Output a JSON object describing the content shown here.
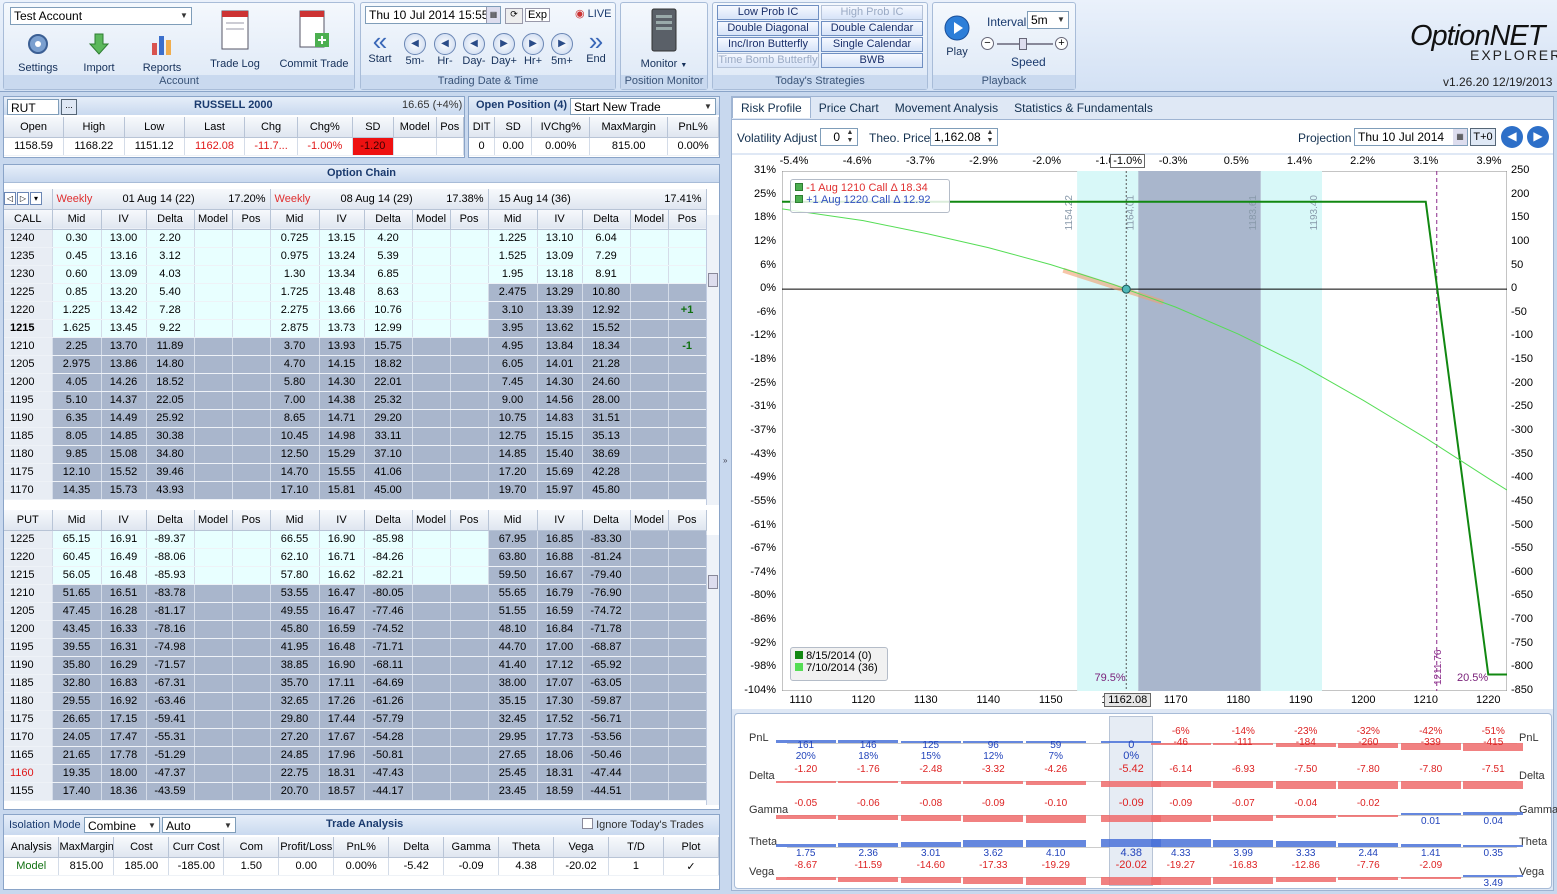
{
  "ribbon": {
    "account": "Test Account",
    "buttons": [
      "Settings",
      "Import",
      "Reports",
      "Trade Log",
      "Commit Trade"
    ],
    "account_title": "Account",
    "datetime": "Thu 10 Jul 2014  15:55",
    "exp": "Exp",
    "live": "LIVE",
    "nav": [
      "Start",
      "5m-",
      "Hr-",
      "Day-",
      "Day+",
      "Hr+",
      "5m+",
      "End"
    ],
    "trading_title": "Trading Date & Time",
    "monitor": "Monitor",
    "monitor_title": "Position Monitor",
    "strategies": [
      [
        "Low Prob IC",
        "High Prob IC"
      ],
      [
        "Double Diagonal",
        "Double Calendar"
      ],
      [
        "Inc/Iron Butterfly",
        "Single Calendar"
      ],
      [
        "Time Bomb Butterfly",
        "BWB"
      ]
    ],
    "strategies_title": "Today's Strategies",
    "play": "Play",
    "interval_label": "Interval",
    "interval": "5m",
    "speed": "Speed",
    "playback_title": "Playback",
    "logo1": "OptionNET",
    "logo2": "EXPLORER",
    "version": "v1.26.20  12/19/2013"
  },
  "quote": {
    "symbol": "RUT",
    "name": "RUSSELL 2000",
    "change": "16.65 (+4%)",
    "headers": [
      "Open",
      "High",
      "Low",
      "Last",
      "Chg",
      "Chg%",
      "SD",
      "Model",
      "Pos"
    ],
    "values": [
      "1158.59",
      "1168.22",
      "1151.12",
      "1162.08",
      "-11.7...",
      "-1.00%",
      "-1.20",
      "",
      ""
    ]
  },
  "position": {
    "title": "Open Position (4)",
    "select": "Start New Trade",
    "headers": [
      "DIT",
      "SD",
      "IVChg%",
      "MaxMargin",
      "PnL%"
    ],
    "values": [
      "0",
      "0.00",
      "0.00%",
      "815.00",
      "0.00%"
    ]
  },
  "chain": {
    "title": "Option Chain",
    "exps": [
      {
        "label": "Weekly",
        "date": "01 Aug 14 (22)",
        "iv": "17.20%"
      },
      {
        "label": "Weekly",
        "date": "08 Aug 14 (29)",
        "iv": "17.38%"
      },
      {
        "label": "",
        "date": "15 Aug 14 (36)",
        "iv": "17.41%"
      }
    ],
    "cols": [
      "Mid",
      "IV",
      "Delta",
      "Model",
      "Pos"
    ],
    "call_label": "CALL",
    "put_label": "PUT",
    "calls": [
      [
        "1240",
        "0.30",
        "13.00",
        "2.20",
        "0.725",
        "13.15",
        "4.20",
        "1.225",
        "13.10",
        "6.04",
        ""
      ],
      [
        "1235",
        "0.45",
        "13.16",
        "3.12",
        "0.975",
        "13.24",
        "5.39",
        "1.525",
        "13.09",
        "7.29",
        ""
      ],
      [
        "1230",
        "0.60",
        "13.09",
        "4.03",
        "1.30",
        "13.34",
        "6.85",
        "1.95",
        "13.18",
        "8.91",
        ""
      ],
      [
        "1225",
        "0.85",
        "13.20",
        "5.40",
        "1.725",
        "13.48",
        "8.63",
        "2.475",
        "13.29",
        "10.80",
        ""
      ],
      [
        "1220",
        "1.225",
        "13.42",
        "7.28",
        "2.275",
        "13.66",
        "10.76",
        "3.10",
        "13.39",
        "12.92",
        "+1"
      ],
      [
        "1215",
        "1.625",
        "13.45",
        "9.22",
        "2.875",
        "13.73",
        "12.99",
        "3.95",
        "13.62",
        "15.52",
        ""
      ],
      [
        "1210",
        "2.25",
        "13.70",
        "11.89",
        "3.70",
        "13.93",
        "15.75",
        "4.95",
        "13.84",
        "18.34",
        "-1"
      ],
      [
        "1205",
        "2.975",
        "13.86",
        "14.80",
        "4.70",
        "14.15",
        "18.82",
        "6.05",
        "14.01",
        "21.28",
        ""
      ],
      [
        "1200",
        "4.05",
        "14.26",
        "18.52",
        "5.80",
        "14.30",
        "22.01",
        "7.45",
        "14.30",
        "24.60",
        ""
      ],
      [
        "1195",
        "5.10",
        "14.37",
        "22.05",
        "7.00",
        "14.38",
        "25.32",
        "9.00",
        "14.56",
        "28.00",
        ""
      ],
      [
        "1190",
        "6.35",
        "14.49",
        "25.92",
        "8.65",
        "14.71",
        "29.20",
        "10.75",
        "14.83",
        "31.51",
        ""
      ],
      [
        "1185",
        "8.05",
        "14.85",
        "30.38",
        "10.45",
        "14.98",
        "33.11",
        "12.75",
        "15.15",
        "35.13",
        ""
      ],
      [
        "1180",
        "9.85",
        "15.08",
        "34.80",
        "12.50",
        "15.29",
        "37.10",
        "14.85",
        "15.40",
        "38.69",
        ""
      ],
      [
        "1175",
        "12.10",
        "15.52",
        "39.46",
        "14.70",
        "15.55",
        "41.06",
        "17.20",
        "15.69",
        "42.28",
        ""
      ],
      [
        "1170",
        "14.35",
        "15.73",
        "43.93",
        "17.10",
        "15.81",
        "45.00",
        "19.70",
        "15.97",
        "45.80",
        ""
      ]
    ],
    "puts": [
      [
        "1225",
        "65.15",
        "16.91",
        "-89.37",
        "66.55",
        "16.90",
        "-85.98",
        "67.95",
        "16.85",
        "-83.30"
      ],
      [
        "1220",
        "60.45",
        "16.49",
        "-88.06",
        "62.10",
        "16.71",
        "-84.26",
        "63.80",
        "16.88",
        "-81.24"
      ],
      [
        "1215",
        "56.05",
        "16.48",
        "-85.93",
        "57.80",
        "16.62",
        "-82.21",
        "59.50",
        "16.67",
        "-79.40"
      ],
      [
        "1210",
        "51.65",
        "16.51",
        "-83.78",
        "53.55",
        "16.47",
        "-80.05",
        "55.65",
        "16.79",
        "-76.90"
      ],
      [
        "1205",
        "47.45",
        "16.28",
        "-81.17",
        "49.55",
        "16.47",
        "-77.46",
        "51.55",
        "16.59",
        "-74.72"
      ],
      [
        "1200",
        "43.45",
        "16.33",
        "-78.16",
        "45.80",
        "16.59",
        "-74.52",
        "48.10",
        "16.84",
        "-71.78"
      ],
      [
        "1195",
        "39.55",
        "16.31",
        "-74.98",
        "41.95",
        "16.48",
        "-71.71",
        "44.70",
        "17.00",
        "-68.87"
      ],
      [
        "1190",
        "35.80",
        "16.29",
        "-71.57",
        "38.85",
        "16.90",
        "-68.11",
        "41.40",
        "17.12",
        "-65.92"
      ],
      [
        "1185",
        "32.80",
        "16.83",
        "-67.31",
        "35.70",
        "17.11",
        "-64.69",
        "38.00",
        "17.07",
        "-63.05"
      ],
      [
        "1180",
        "29.55",
        "16.92",
        "-63.46",
        "32.65",
        "17.26",
        "-61.26",
        "35.15",
        "17.30",
        "-59.87"
      ],
      [
        "1175",
        "26.65",
        "17.15",
        "-59.41",
        "29.80",
        "17.44",
        "-57.79",
        "32.45",
        "17.52",
        "-56.71"
      ],
      [
        "1170",
        "24.05",
        "17.47",
        "-55.31",
        "27.20",
        "17.67",
        "-54.28",
        "29.95",
        "17.73",
        "-53.56"
      ],
      [
        "1165",
        "21.65",
        "17.78",
        "-51.29",
        "24.85",
        "17.96",
        "-50.81",
        "27.65",
        "18.06",
        "-50.46"
      ],
      [
        "1160",
        "19.35",
        "18.00",
        "-47.37",
        "22.75",
        "18.31",
        "-47.43",
        "25.45",
        "18.31",
        "-47.44"
      ],
      [
        "1155",
        "17.40",
        "18.36",
        "-43.59",
        "20.70",
        "18.57",
        "-44.17",
        "23.45",
        "18.59",
        "-44.51"
      ]
    ]
  },
  "analysis": {
    "iso": "Isolation",
    "mode": "Mode",
    "combine": "Combine",
    "auto": "Auto",
    "title": "Trade Analysis",
    "ignore": "Ignore Today's Trades",
    "headers": [
      "Analysis",
      "MaxMargin",
      "Cost",
      "Curr Cost",
      "Com",
      "Profit/Loss",
      "PnL%",
      "Delta",
      "Gamma",
      "Theta",
      "Vega",
      "T/D",
      "Plot"
    ],
    "values": [
      "Model",
      "815.00",
      "185.00",
      "-185.00",
      "1.50",
      "0.00",
      "0.00%",
      "-5.42",
      "-0.09",
      "4.38",
      "-20.02",
      "1",
      "✓"
    ]
  },
  "right": {
    "tabs": [
      "Risk Profile",
      "Price Chart",
      "Movement Analysis",
      "Statistics & Fundamentals"
    ],
    "vol_label": "Volatility Adjust",
    "vol": "0",
    "theo_label": "Theo. Price",
    "theo": "1,162.08",
    "proj_label": "Projection",
    "proj": "Thu 10 Jul 2014",
    "t0": "T+0"
  },
  "chart_data": {
    "type": "line",
    "top_ticks": [
      "-5.4%",
      "-4.6%",
      "-3.7%",
      "-2.9%",
      "-2.0%",
      "-1.0%",
      "-0.3%",
      "0.5%",
      "1.4%",
      "2.2%",
      "3.1%",
      "3.9%"
    ],
    "x_ticks": [
      1110,
      1120,
      1130,
      1140,
      1150,
      1160,
      1170,
      1180,
      1190,
      1200,
      1210,
      1220
    ],
    "xlim": [
      1107,
      1223
    ],
    "left_ticks": [
      "31%",
      "25%",
      "18%",
      "12%",
      "6%",
      "0%",
      "-6%",
      "-12%",
      "-18%",
      "-25%",
      "-31%",
      "-37%",
      "-43%",
      "-49%",
      "-55%",
      "-61%",
      "-67%",
      "-74%",
      "-80%",
      "-86%",
      "-92%",
      "-98%",
      "-104%"
    ],
    "right_ticks": [
      "250",
      "200",
      "150",
      "100",
      "50",
      "0",
      "-50",
      "-100",
      "-150",
      "-200",
      "-250",
      "-300",
      "-350",
      "-400",
      "-450",
      "-500",
      "-550",
      "-600",
      "-650",
      "-700",
      "-750",
      "-800",
      "-850"
    ],
    "ylim": [
      -850,
      250
    ],
    "legend_top": [
      {
        "text": "-1 Aug 1210 Call Δ 18.34",
        "color": "#e03030"
      },
      {
        "text": "+1 Aug 1220 Call Δ 12.92",
        "color": "#3050c0"
      }
    ],
    "legend_bottom": [
      "8/15/2014 (0)",
      "7/10/2014 (36)"
    ],
    "series": [
      {
        "name": "8/15/2014 (0)",
        "color": "#118811",
        "x": [
          1107,
          1210,
          1220,
          1223
        ],
        "y": [
          185,
          185,
          -815,
          -815
        ]
      },
      {
        "name": "7/10/2014 (36)",
        "color": "#55dd55",
        "x": [
          1107,
          1120,
          1130,
          1140,
          1150,
          1160,
          1162.08,
          1170,
          1180,
          1190,
          1200,
          1210,
          1220,
          1223
        ],
        "y": [
          170,
          145,
          118,
          88,
          52,
          10,
          0,
          -38,
          -95,
          -160,
          -235,
          -315,
          -400,
          -425
        ]
      }
    ],
    "bands": [
      {
        "from": 1154.22,
        "to": 1164.01,
        "label_from": "1154.22",
        "label_to": "1164.01",
        "color": "#d8f8f8"
      },
      {
        "from": 1164.01,
        "to": 1183.61,
        "label_to": "1183.61",
        "color": "#a9b6cc"
      },
      {
        "from": 1183.61,
        "to": 1193.4,
        "label_to": "1193.40",
        "color": "#d8f8f8"
      }
    ],
    "current_price": "1162.08",
    "current_x": 1162.08,
    "current_pct": "-1.0%",
    "breakeven": 1211.76,
    "breakeven_label": "1211.76",
    "prob_left": "79.5%",
    "prob_right": "20.5%",
    "greeks": {
      "labels": [
        "PnL",
        "Delta",
        "Gamma",
        "Theta",
        "Vega"
      ],
      "x": [
        1110,
        1120,
        1130,
        1140,
        1150,
        1162.08,
        1170,
        1180,
        1190,
        1200,
        1210,
        1220
      ],
      "pnl": [
        [
          "161",
          "20%"
        ],
        [
          "146",
          "18%"
        ],
        [
          "125",
          "15%"
        ],
        [
          "96",
          "12%"
        ],
        [
          "59",
          "7%"
        ],
        [
          "0",
          "0%"
        ],
        [
          "-6%",
          "-46"
        ],
        [
          "-14%",
          "-111"
        ],
        [
          "-23%",
          "-184"
        ],
        [
          "-32%",
          "-260"
        ],
        [
          "-42%",
          "-339"
        ],
        [
          "-51%",
          "-415"
        ]
      ],
      "delta": [
        "-1.20",
        "-1.76",
        "-2.48",
        "-3.32",
        "-4.26",
        "-5.42",
        "-6.14",
        "-6.93",
        "-7.50",
        "-7.80",
        "-7.80",
        "-7.51"
      ],
      "gamma": [
        "-0.05",
        "-0.06",
        "-0.08",
        "-0.09",
        "-0.10",
        "-0.09",
        "-0.09",
        "-0.07",
        "-0.04",
        "-0.02",
        "0.01",
        "0.04"
      ],
      "theta": [
        "1.75",
        "2.36",
        "3.01",
        "3.62",
        "4.10",
        "4.38",
        "4.33",
        "3.99",
        "3.33",
        "2.44",
        "1.41",
        "0.35"
      ],
      "vega": [
        "-8.67",
        "-11.59",
        "-14.60",
        "-17.33",
        "-19.29",
        "-20.02",
        "-19.27",
        "-16.83",
        "-12.86",
        "-7.76",
        "-2.09",
        "3.49"
      ]
    }
  }
}
